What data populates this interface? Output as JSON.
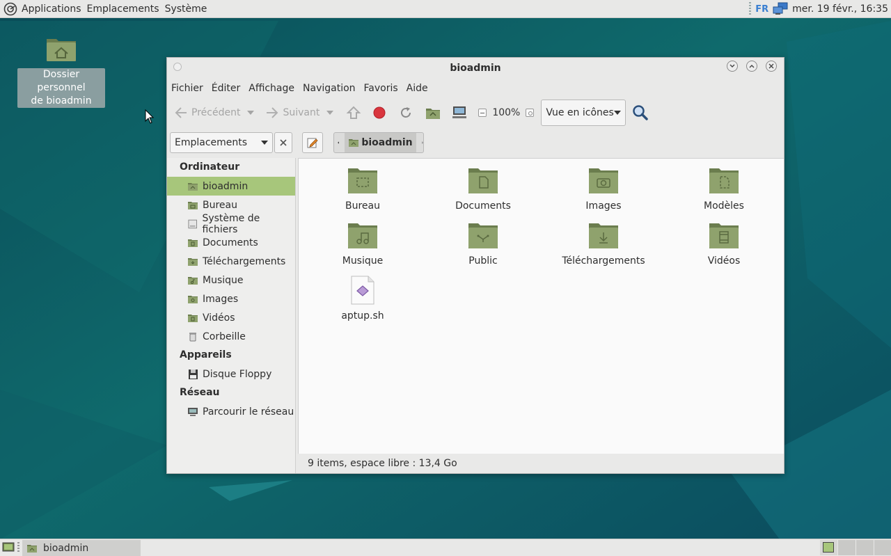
{
  "top_panel": {
    "menus": [
      "Applications",
      "Emplacements",
      "Système"
    ],
    "keyboard_layout": "FR",
    "clock": "mer. 19 févr., 16:35"
  },
  "desktop": {
    "icon_label_line1": "Dossier personnel",
    "icon_label_line2": "de bioadmin"
  },
  "window": {
    "title": "bioadmin",
    "menubar": [
      "Fichier",
      "Éditer",
      "Affichage",
      "Navigation",
      "Favoris",
      "Aide"
    ],
    "toolbar": {
      "back_label": "Précédent",
      "forward_label": "Suivant",
      "zoom": "100%",
      "view_mode": "Vue en icônes"
    },
    "location": {
      "side_pane_selector": "Emplacements",
      "breadcrumb": "bioadmin"
    },
    "sidebar": {
      "sections": [
        {
          "title": "Ordinateur",
          "items": [
            {
              "label": "bioadmin",
              "icon": "home-folder-icon",
              "selected": true
            },
            {
              "label": "Bureau",
              "icon": "folder-icon"
            },
            {
              "label": "Système de fichiers",
              "icon": "drive-icon"
            },
            {
              "label": "Documents",
              "icon": "folder-icon"
            },
            {
              "label": "Téléchargements",
              "icon": "folder-icon"
            },
            {
              "label": "Musique",
              "icon": "folder-icon"
            },
            {
              "label": "Images",
              "icon": "folder-icon"
            },
            {
              "label": "Vidéos",
              "icon": "folder-icon"
            },
            {
              "label": "Corbeille",
              "icon": "trash-icon"
            }
          ]
        },
        {
          "title": "Appareils",
          "items": [
            {
              "label": "Disque Floppy",
              "icon": "floppy-icon"
            }
          ]
        },
        {
          "title": "Réseau",
          "items": [
            {
              "label": "Parcourir le réseau",
              "icon": "network-icon"
            }
          ]
        }
      ]
    },
    "files": [
      {
        "name": "Bureau",
        "type": "folder",
        "emblem": "desktop"
      },
      {
        "name": "Documents",
        "type": "folder",
        "emblem": "document"
      },
      {
        "name": "Images",
        "type": "folder",
        "emblem": "camera"
      },
      {
        "name": "Modèles",
        "type": "folder",
        "emblem": "template"
      },
      {
        "name": "Musique",
        "type": "folder",
        "emblem": "music"
      },
      {
        "name": "Public",
        "type": "folder",
        "emblem": "share"
      },
      {
        "name": "Téléchargements",
        "type": "folder",
        "emblem": "download"
      },
      {
        "name": "Vidéos",
        "type": "folder",
        "emblem": "video"
      },
      {
        "name": "aptup.sh",
        "type": "script",
        "emblem": "script"
      }
    ],
    "status": "9 items, espace libre : 13,4 Go"
  },
  "taskbar": {
    "task_label": "bioadmin"
  },
  "colors": {
    "folder": "#8fa26d",
    "folder_dark": "#6b7d4e",
    "selection": "#a7c67b",
    "desktop": "#0e5a63"
  }
}
